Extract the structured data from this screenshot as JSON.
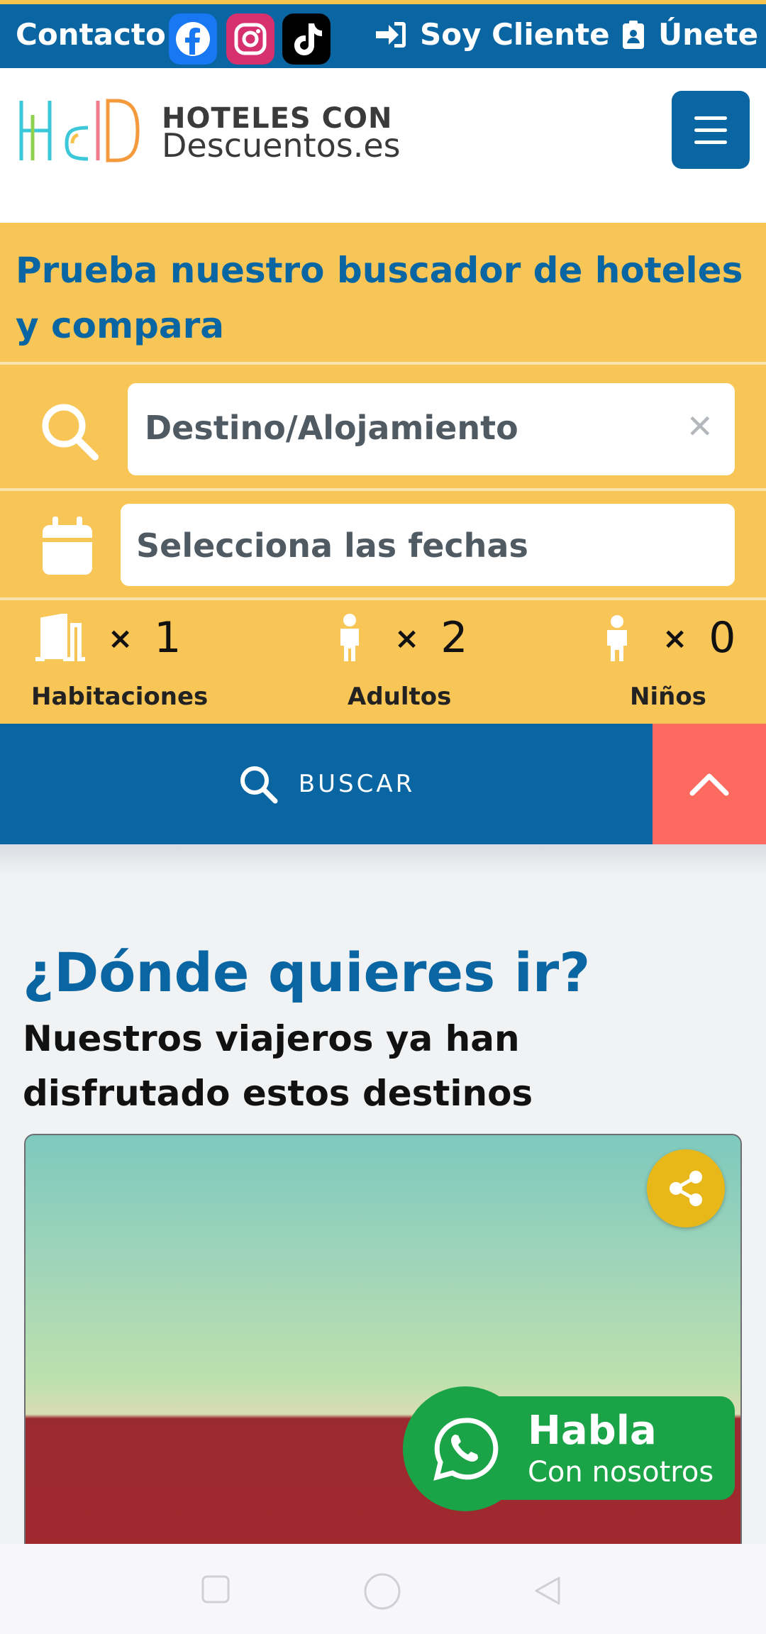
{
  "topbar": {
    "contact": "Contacto",
    "social": [
      "facebook-icon",
      "instagram-icon",
      "tiktok-icon"
    ],
    "client": "Soy Cliente",
    "join": "Únete"
  },
  "header": {
    "brand_line1": "HOTELES CON",
    "brand_line2": "Descuentos.es"
  },
  "search": {
    "title": "Prueba nuestro buscador de hoteles y compara",
    "destination_placeholder": "Destino/Alojamiento",
    "dates_placeholder": "Selecciona las fechas",
    "rooms_label": "Habitaciones",
    "rooms_value": "1",
    "adults_label": "Adultos",
    "adults_value": "2",
    "children_label": "Niños",
    "children_value": "0",
    "times": "×",
    "button_label": "BUSCAR"
  },
  "main": {
    "heading": "¿Dónde quieres ir?",
    "subheading": "Nuestros viajeros ya han disfrutado estos destinos"
  },
  "whatsapp": {
    "title": "Habla",
    "subtitle": "Con nosotros"
  },
  "colors": {
    "primary": "#0a66a2",
    "panel": "#f8c557",
    "accent": "#fd6a60",
    "whatsapp": "#1aa447",
    "share": "#e8b81a"
  }
}
